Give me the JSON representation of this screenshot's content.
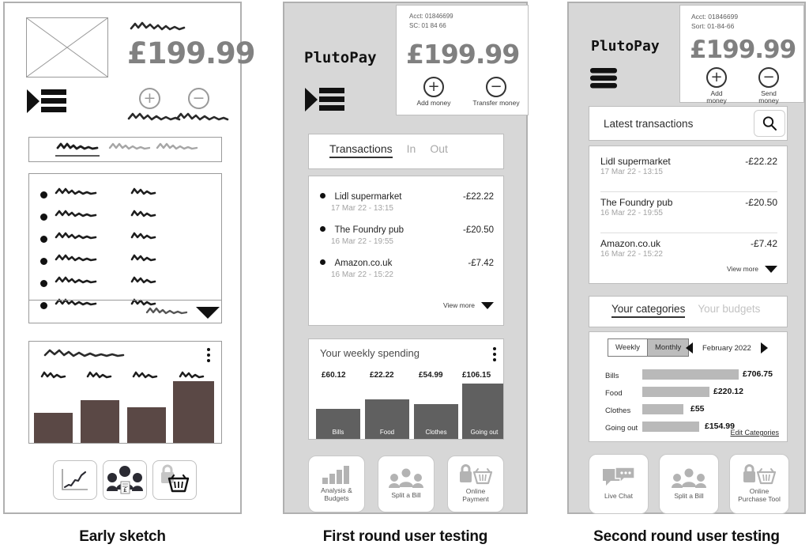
{
  "panels": [
    {
      "caption": "Early sketch",
      "style": "sketch",
      "amount": "£199.99",
      "plus": "+",
      "minus": "−"
    },
    {
      "caption": "First round user testing",
      "brand": "PlutoPay",
      "account": {
        "acct": "Acct: 01846699",
        "sort": "SC: 01 84 66"
      },
      "amount": "£199.99",
      "actions": [
        {
          "icon": "+",
          "label": "Add money"
        },
        {
          "icon": "−",
          "label": "Transfer money"
        }
      ],
      "tabs": [
        {
          "label": "Transactions",
          "active": true
        },
        {
          "label": "In",
          "active": false
        },
        {
          "label": "Out",
          "active": false
        }
      ],
      "transactions": [
        {
          "name": "Lidl supermarket",
          "date": "17 Mar 22 - 13:15",
          "amount": "-£22.22"
        },
        {
          "name": "The Foundry pub",
          "date": "16 Mar 22 - 19:55",
          "amount": "-£20.50"
        },
        {
          "name": "Amazon.co.uk",
          "date": "16 Mar 22 - 15:22",
          "amount": "-£7.42"
        }
      ],
      "view_more": "View more",
      "spending_title": "Your weekly spending",
      "nav": [
        {
          "icon": "bar-chart-icon",
          "label": "Analysis &\nBudgets"
        },
        {
          "icon": "people-icon",
          "label": "Split a Bill"
        },
        {
          "icon": "lock-basket-icon",
          "label": "Online\nPayment"
        }
      ]
    },
    {
      "caption": "Second round user testing",
      "brand": "PlutoPay",
      "account": {
        "acct": "Acct: 01846699",
        "sort": "Sort: 01-84-66"
      },
      "amount": "£199.99",
      "actions": [
        {
          "icon": "+",
          "label": "Add\nmoney"
        },
        {
          "icon": "−",
          "label": "Send\nmoney"
        }
      ],
      "search_placeholder": "Latest transactions",
      "transactions": [
        {
          "name": "Lidl supermarket",
          "date": "17 Mar 22 - 13:15",
          "amount": "-£22.22"
        },
        {
          "name": "The Foundry pub",
          "date": "16 Mar 22 - 19:55",
          "amount": "-£20.50"
        },
        {
          "name": "Amazon.co.uk",
          "date": "16 Mar 22 - 15:22",
          "amount": "-£7.42"
        }
      ],
      "view_more": "View more",
      "cat_tabs": [
        {
          "label": "Your categories",
          "active": true
        },
        {
          "label": "Your budgets",
          "active": false
        }
      ],
      "period_segments": [
        {
          "label": "Weekly",
          "active": false
        },
        {
          "label": "Monthly",
          "active": true
        }
      ],
      "month": "February 2022",
      "edit_categories": "Edit Categories",
      "nav": [
        {
          "icon": "chat-icon",
          "label": "Live Chat"
        },
        {
          "icon": "people-icon",
          "label": "Split a Bill"
        },
        {
          "icon": "lock-basket-icon",
          "label": "Online\nPurchase Tool"
        }
      ]
    }
  ],
  "chart_data": [
    {
      "type": "bar",
      "title": "Your weekly spending",
      "categories": [
        "Bills",
        "Food",
        "Clothes",
        "Going out"
      ],
      "values": [
        60.12,
        22.22,
        54.99,
        106.15
      ],
      "value_labels": [
        "£60.12",
        "£22.22",
        "£54.99",
        "£106.15"
      ],
      "xlabel": "",
      "ylabel": "",
      "ylim": [
        0,
        120
      ],
      "grid": false,
      "legend": "none",
      "panel": "First round user testing"
    },
    {
      "type": "bar",
      "title": "Your categories",
      "orientation": "horizontal",
      "categories": [
        "Bills",
        "Food",
        "Clothes",
        "Going out"
      ],
      "values": [
        706.75,
        220.12,
        55,
        154.99
      ],
      "value_labels": [
        "£706.75",
        "£220.12",
        "£55",
        "£154.99"
      ],
      "period": "February 2022",
      "xlabel": "",
      "ylabel": "",
      "xlim": [
        0,
        800
      ],
      "grid": false,
      "legend": "none",
      "panel": "Second round user testing"
    },
    {
      "type": "bar",
      "title": "",
      "categories": [
        "",
        "",
        "",
        ""
      ],
      "values": [
        38,
        55,
        45,
        78
      ],
      "value_labels": [
        "",
        "",
        "",
        ""
      ],
      "xlabel": "",
      "ylabel": "",
      "ylim": [
        0,
        100
      ],
      "grid": false,
      "legend": "none",
      "panel": "Early sketch"
    }
  ]
}
